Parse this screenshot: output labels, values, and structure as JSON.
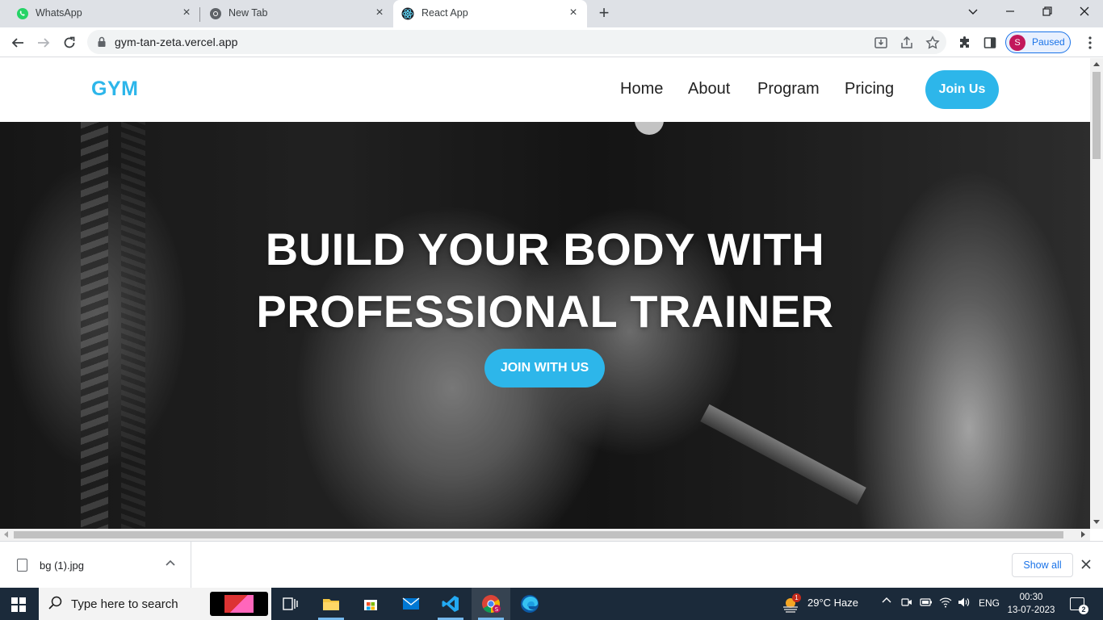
{
  "browser": {
    "tabs": [
      {
        "label": "WhatsApp",
        "icon": "whatsapp-icon",
        "active": false
      },
      {
        "label": "New Tab",
        "icon": "chrome-icon",
        "active": false
      },
      {
        "label": "React App",
        "icon": "react-icon",
        "active": true
      }
    ],
    "url": "gym-tan-zeta.vercel.app",
    "profile_initial": "S",
    "profile_status": "Paused"
  },
  "site": {
    "brand": "GYM",
    "nav": [
      "Home",
      "About",
      "Program",
      "Pricing"
    ],
    "join_button": "Join Us",
    "hero": {
      "headline_line1": "BUILD YOUR BODY WITH",
      "headline_line2": "PROFESSIONAL TRAINER",
      "cta": "JOIN WITH US"
    },
    "accent_color": "#2db6ea"
  },
  "downloads": {
    "file_name": "bg (1).jpg",
    "show_all": "Show all"
  },
  "taskbar": {
    "search_placeholder": "Type here to search",
    "weather": "29°C  Haze",
    "language": "ENG",
    "time": "00:30",
    "date": "13-07-2023",
    "notification_count": "2",
    "weather_badge": "1"
  }
}
